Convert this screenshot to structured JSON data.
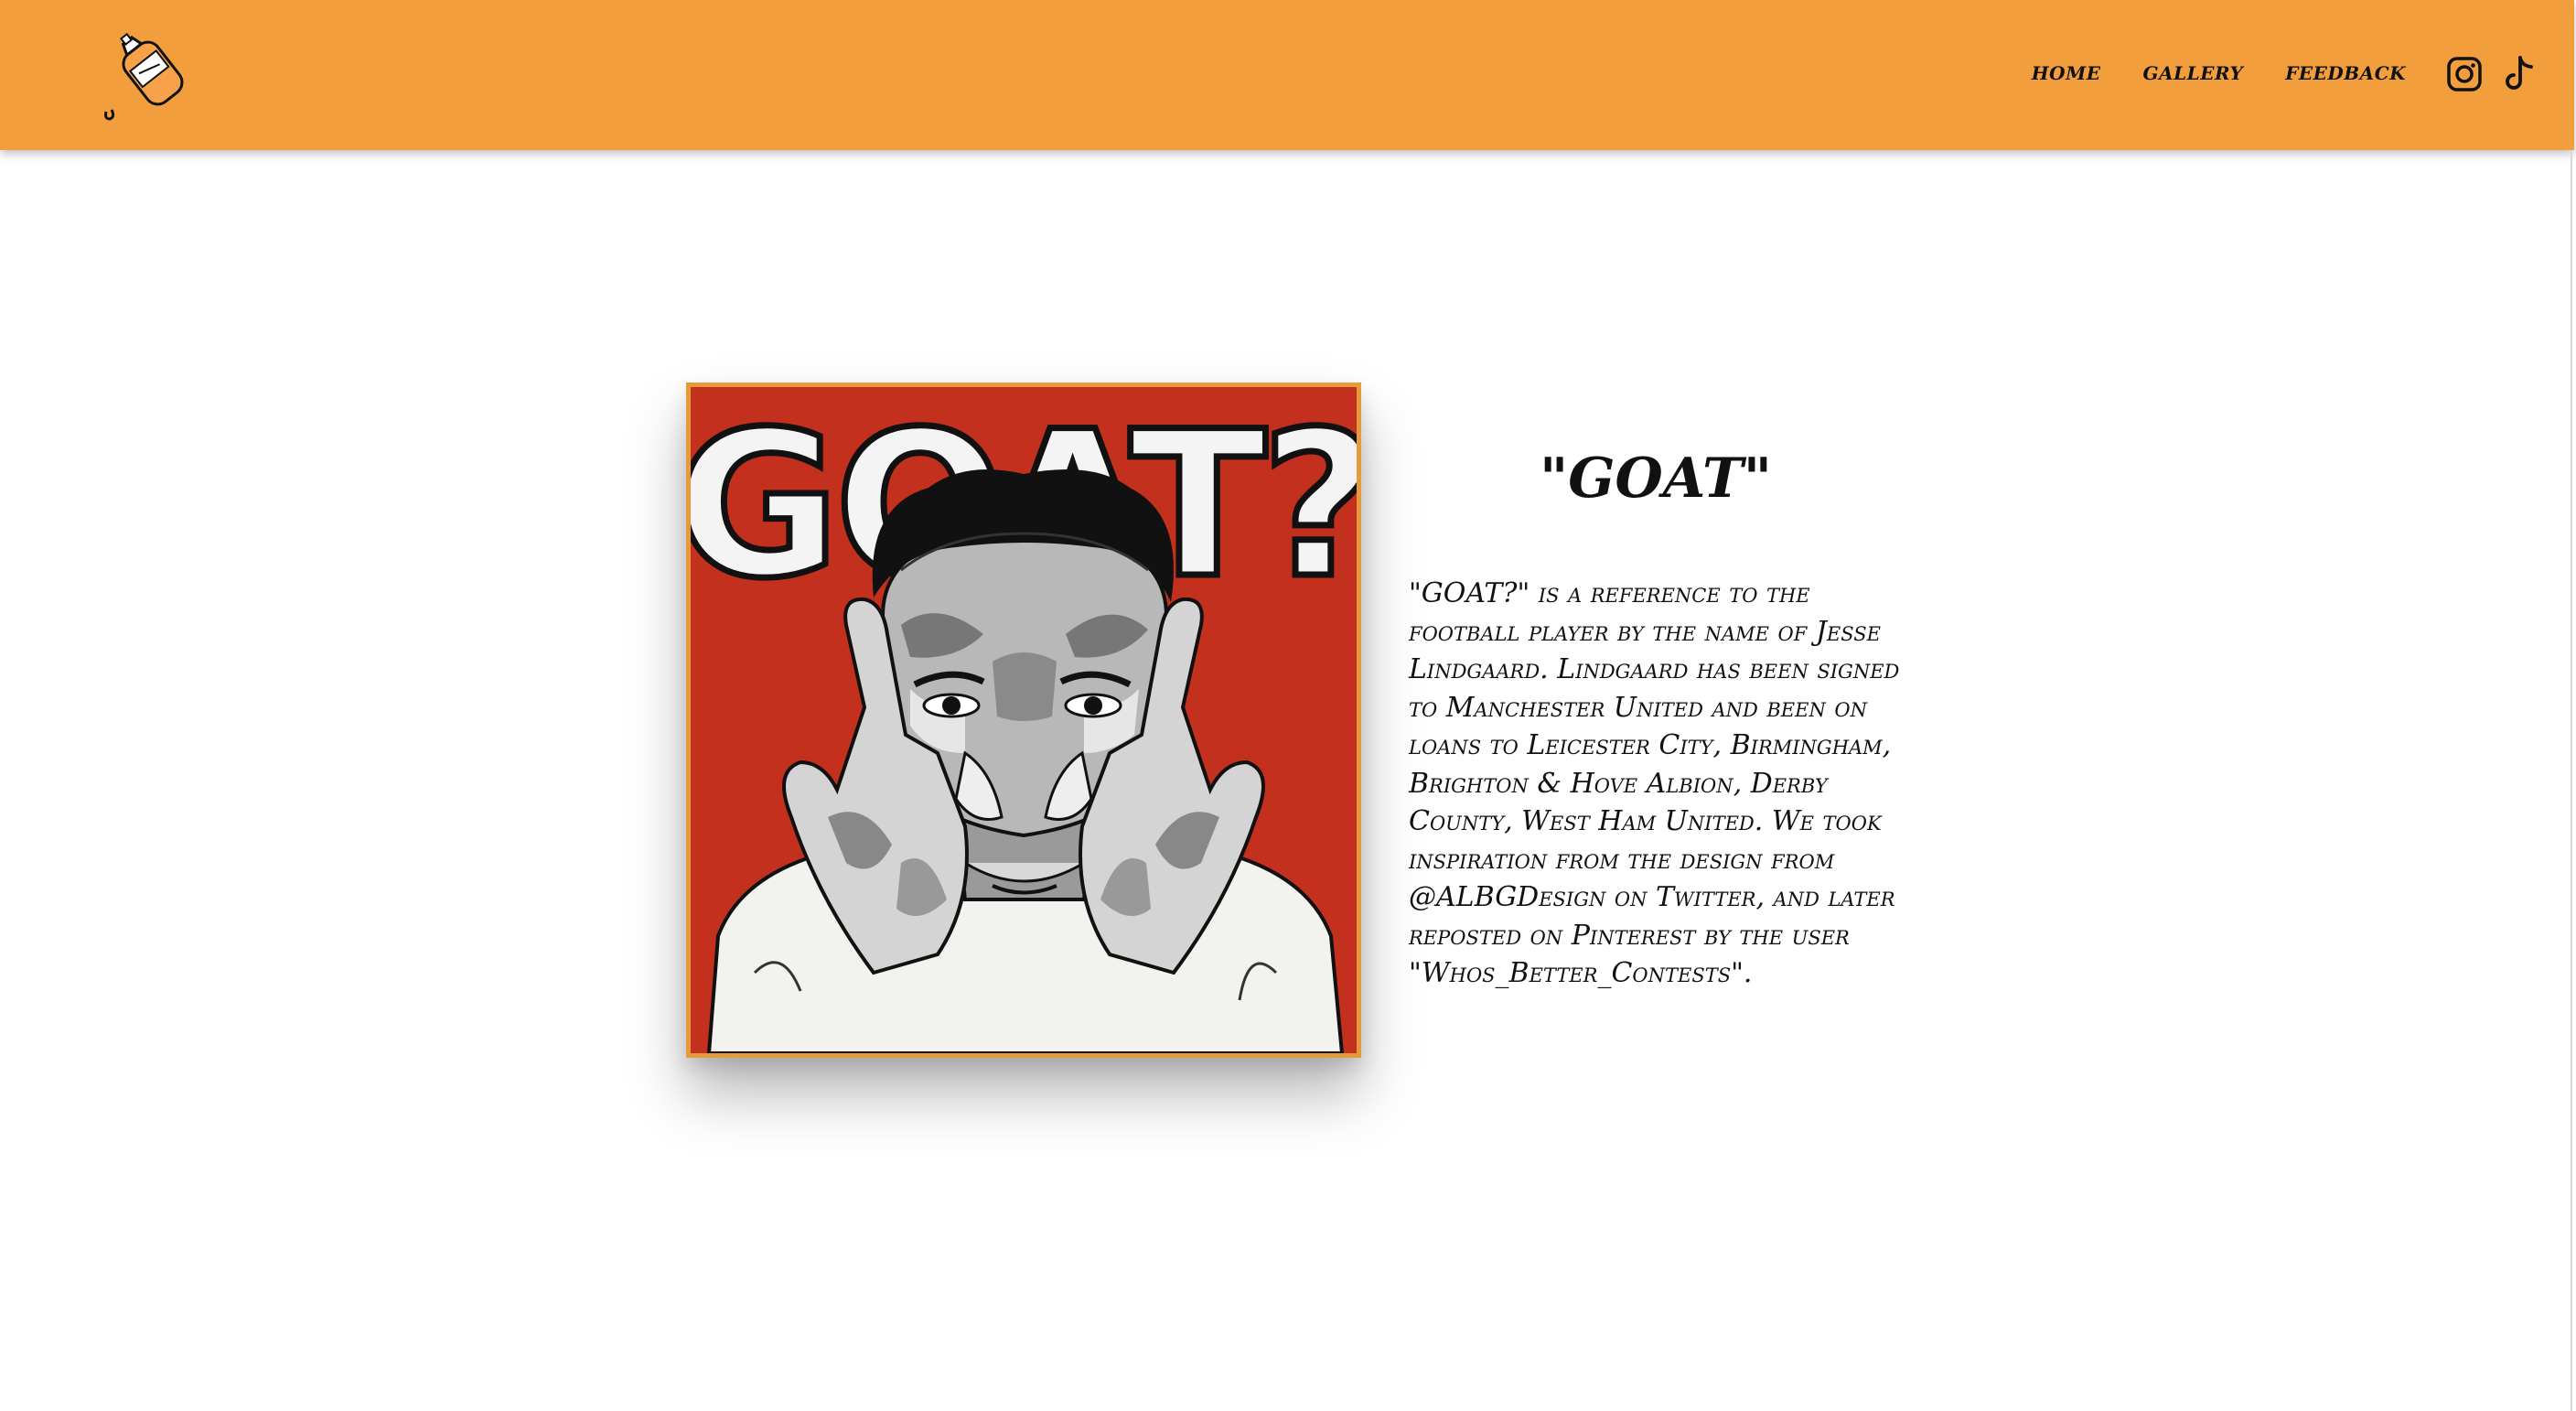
{
  "nav": {
    "logo_icon": "sauce-bottle-icon",
    "links": [
      {
        "label": "home"
      },
      {
        "label": "gallery"
      },
      {
        "label": "feedback"
      }
    ],
    "social": [
      {
        "icon": "instagram-icon"
      },
      {
        "icon": "tiktok-icon"
      }
    ]
  },
  "artwork": {
    "image_text": "GOAT?"
  },
  "content": {
    "title": "\"GOAT\"",
    "description": "\"GOAT?\" is a reference to the football player by the name of Jesse Lindgaard. Lindgaard has been signed to Manchester United and been on loans to Leicester City, Birmingham, Brighton & Hove Albion, Derby County, West Ham United. We took inspiration from the design from @ALBGDesign on Twitter, and later reposted on Pinterest by the user \"Whos_Better_Contests\"."
  },
  "colors": {
    "nav_bg": "#f29e3d",
    "frame_border": "#e59a3c",
    "artwork_bg": "#c8321f"
  }
}
